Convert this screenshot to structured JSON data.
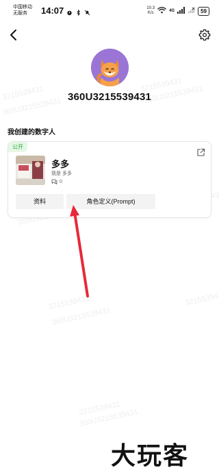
{
  "status_bar": {
    "carrier_line1": "中国移动",
    "carrier_line2": "无服务",
    "time": "14:07",
    "net_speed_value": "10.3",
    "net_speed_unit": "K/s",
    "network": "4G",
    "battery": "59"
  },
  "profile": {
    "username": "360U3215539431"
  },
  "section": {
    "title": "我创建的数字人"
  },
  "card": {
    "tag": "公开",
    "name": "多多",
    "description": "我是 多多",
    "comment_count": "0",
    "profile_button": "资料",
    "prompt_button": "角色定义(Prompt)"
  },
  "watermark": {
    "line1": "3215539431",
    "line2": "360U3215539431"
  },
  "site_logo": "大玩客",
  "colors": {
    "avatar_bg": "#9a75d6",
    "tag_bg": "#e6f7e6",
    "tag_text": "#2fa83c",
    "arrow": "#e8283a"
  }
}
